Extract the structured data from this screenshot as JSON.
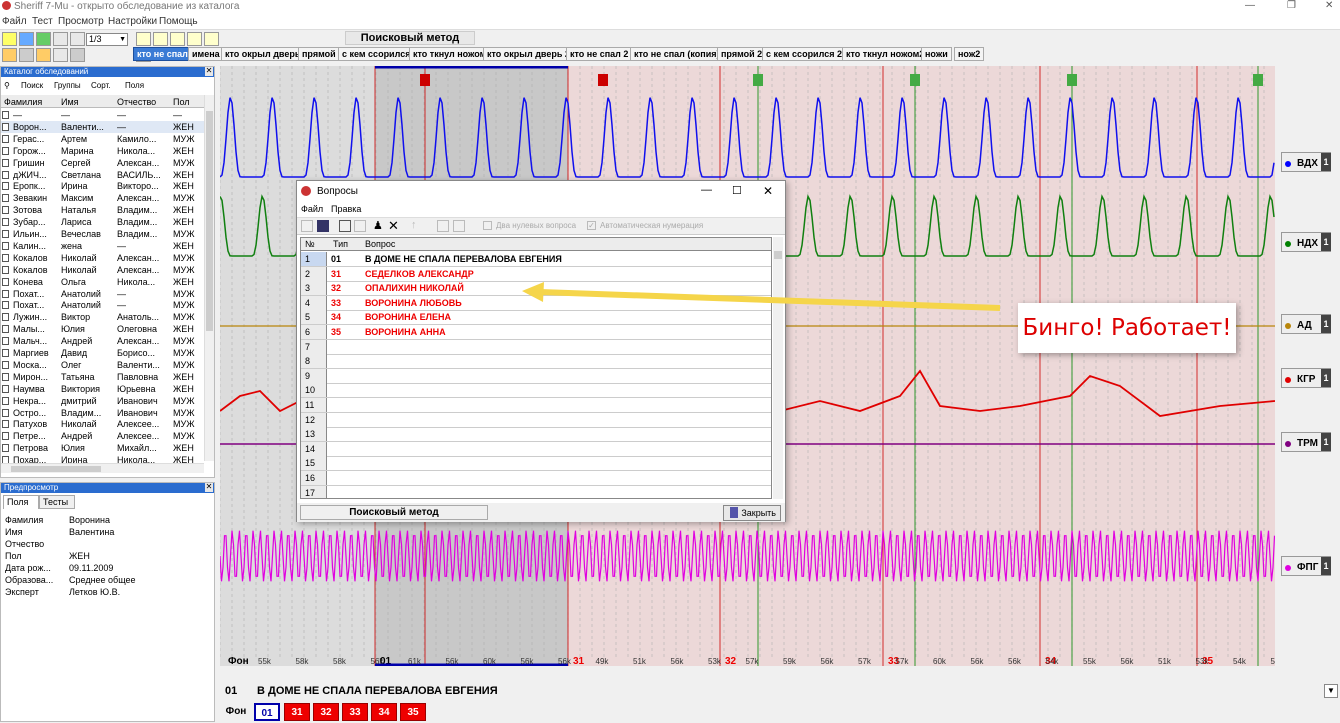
{
  "window": {
    "title": "Sheriff 7-Mu - открыто обследование из каталога"
  },
  "menu": [
    "Файл",
    "Тест",
    "Просмотр",
    "Настройки",
    "Помощь"
  ],
  "toolbar": {
    "page_select": "1/3",
    "method_label": "Поисковый метод",
    "question_buttons": [
      "кто не спал",
      "имена",
      "кто окрыл дверь",
      "прямой",
      "с кем ссорился",
      "кто ткнул ножом",
      "кто окрыл дверь 2",
      "кто не спал 2",
      "кто не спал (копия)",
      "прямой 2",
      "с кем ссорился 2",
      "кто ткнул ножом2",
      "ножи",
      "нож2"
    ]
  },
  "catalog": {
    "title": "Каталог обследований",
    "tools": [
      "Поиск",
      "Группы",
      "Сорт.",
      "Поля"
    ],
    "columns": [
      "Фамилия",
      "Имя",
      "Отчество",
      "Пол"
    ],
    "rows": [
      [
        "—",
        "—",
        "—",
        "—"
      ],
      [
        "Ворон...",
        "Валенти...",
        "—",
        "ЖЕН"
      ],
      [
        "Герас...",
        "Артем",
        "Камило...",
        "МУЖ"
      ],
      [
        "Горож...",
        "Марина",
        "Никола...",
        "ЖЕН"
      ],
      [
        "Гришин",
        "Сергей",
        "Алексан...",
        "МУЖ"
      ],
      [
        "дЖИЧ...",
        "Светлана",
        "ВАСИЛЬ...",
        "ЖЕН"
      ],
      [
        "Еропк...",
        "Ирина",
        "Викторо...",
        "ЖЕН"
      ],
      [
        "Зевакин",
        "Максим",
        "Алексан...",
        "МУЖ"
      ],
      [
        "Зотова",
        "Наталья",
        "Владим...",
        "ЖЕН"
      ],
      [
        "Зубар...",
        "Лариса",
        "Владим...",
        "ЖЕН"
      ],
      [
        "Ильин...",
        "Вечеслав",
        "Владим...",
        "МУЖ"
      ],
      [
        "Калин...",
        "жена",
        "—",
        "ЖЕН"
      ],
      [
        "Кокалов",
        "Николай",
        "Алексан...",
        "МУЖ"
      ],
      [
        "Кокалов",
        "Николай",
        "Алексан...",
        "МУЖ"
      ],
      [
        "Конева",
        "Ольга",
        "Никола...",
        "ЖЕН"
      ],
      [
        "Похат...",
        "Анатолий",
        "—",
        "МУЖ"
      ],
      [
        "Похат...",
        "Анатолий",
        "—",
        "МУЖ"
      ],
      [
        "Лужин...",
        "Виктор",
        "Анатоль...",
        "МУЖ"
      ],
      [
        "Малы...",
        "Юлия",
        "Олеговна",
        "ЖЕН"
      ],
      [
        "Мальч...",
        "Андрей",
        "Алексан...",
        "МУЖ"
      ],
      [
        "Маргиев",
        "Давид",
        "Борисо...",
        "МУЖ"
      ],
      [
        "Моска...",
        "Олег",
        "Валенти...",
        "МУЖ"
      ],
      [
        "Мирон...",
        "Татьяна",
        "Павловна",
        "ЖЕН"
      ],
      [
        "Наумва",
        "Виктория",
        "Юрьевна",
        "ЖЕН"
      ],
      [
        "Некра...",
        "дмитрий",
        "Иванович",
        "МУЖ"
      ],
      [
        "Остро...",
        "Владим...",
        "Иванович",
        "МУЖ"
      ],
      [
        "Патухов",
        "Николай",
        "Алексее...",
        "МУЖ"
      ],
      [
        "Петре...",
        "Андрей",
        "Алексее...",
        "МУЖ"
      ],
      [
        "Петрова",
        "Юлия",
        "Михайл...",
        "ЖЕН"
      ],
      [
        "Похар...",
        "Ирина",
        "Никола...",
        "ЖЕН"
      ]
    ]
  },
  "preview": {
    "title": "Предпросмотр",
    "tabs": [
      "Поля",
      "Тесты"
    ],
    "fields": [
      [
        "Фамилия",
        "Воронина"
      ],
      [
        "Имя",
        "Валентина"
      ],
      [
        "Отчество",
        ""
      ],
      [
        "Пол",
        "ЖЕН"
      ],
      [
        "Дата рож...",
        "09.11.2009"
      ],
      [
        "Образова...",
        "Среднее общее"
      ],
      [
        "Эксперт",
        "Летков Ю.В."
      ]
    ]
  },
  "channels": [
    {
      "name": "ВДХ",
      "num": "1",
      "color": "#0000ff"
    },
    {
      "name": "НДХ",
      "num": "1",
      "color": "#008000"
    },
    {
      "name": "АД",
      "num": "1",
      "color": "#b8860b"
    },
    {
      "name": "КГР",
      "num": "1",
      "color": "#e00000"
    },
    {
      "name": "ТРМ",
      "num": "1",
      "color": "#800080"
    },
    {
      "name": "ФПГ",
      "num": "1",
      "color": "#e000e0"
    }
  ],
  "chart_data": {
    "type": "line",
    "series": [
      {
        "name": "ВДХ",
        "color": "#0000ff"
      },
      {
        "name": "НДХ",
        "color": "#008000"
      },
      {
        "name": "АД",
        "color": "#b8860b"
      },
      {
        "name": "КГР",
        "color": "#e00000"
      },
      {
        "name": "ТРМ",
        "color": "#800080"
      },
      {
        "name": "ФПГ",
        "color": "#e000e0"
      }
    ],
    "question_markers": [
      "01",
      "31",
      "32",
      "33",
      "34",
      "35"
    ],
    "background_label": "Фон",
    "tick_labels": [
      "55k",
      "58k",
      "58k",
      "56k",
      "61k",
      "56k",
      "60k",
      "56k",
      "56k",
      "49k",
      "51k",
      "56k",
      "53k",
      "57k",
      "59k",
      "56k",
      "57k",
      "57k",
      "60k",
      "56k",
      "56k",
      "54k",
      "55k",
      "56k",
      "51k",
      "53k",
      "54k",
      "53k"
    ]
  },
  "dialog": {
    "title": "Вопросы",
    "menu": [
      "Файл",
      "Правка"
    ],
    "options": [
      "Два нулевых вопроса",
      "Автоматическая нумерация"
    ],
    "columns": [
      "№",
      "Тип",
      "Вопрос"
    ],
    "rows": [
      {
        "no": "1",
        "type": "01",
        "text": "В ДОМЕ НЕ СПАЛА ПЕРЕВАЛОВА ЕВГЕНИЯ"
      },
      {
        "no": "2",
        "type": "31",
        "text": "СЕДЕЛКОВ АЛЕКСАНДР"
      },
      {
        "no": "3",
        "type": "32",
        "text": "ОПАЛИХИН НИКОЛАЙ"
      },
      {
        "no": "4",
        "type": "33",
        "text": "ВОРОНИНА ЛЮБОВЬ"
      },
      {
        "no": "5",
        "type": "34",
        "text": "ВОРОНИНА ЕЛЕНА"
      },
      {
        "no": "6",
        "type": "35",
        "text": "ВОРОНИНА АННА"
      },
      {
        "no": "7",
        "type": "",
        "text": ""
      },
      {
        "no": "8",
        "type": "",
        "text": ""
      },
      {
        "no": "9",
        "type": "",
        "text": ""
      },
      {
        "no": "10",
        "type": "",
        "text": ""
      },
      {
        "no": "11",
        "type": "",
        "text": ""
      },
      {
        "no": "12",
        "type": "",
        "text": ""
      },
      {
        "no": "13",
        "type": "",
        "text": ""
      },
      {
        "no": "14",
        "type": "",
        "text": ""
      },
      {
        "no": "15",
        "type": "",
        "text": ""
      },
      {
        "no": "16",
        "type": "",
        "text": ""
      },
      {
        "no": "17",
        "type": "",
        "text": ""
      }
    ],
    "method": "Поисковый метод",
    "close_label": "Закрыть"
  },
  "annotation": "Бинго! Работает!",
  "bottom": {
    "question_num": "01",
    "question_text": "В ДОМЕ НЕ СПАЛА ПЕРЕВАЛОВА ЕВГЕНИЯ",
    "tabs": [
      "Фон",
      "01",
      "31",
      "32",
      "33",
      "34",
      "35"
    ]
  }
}
